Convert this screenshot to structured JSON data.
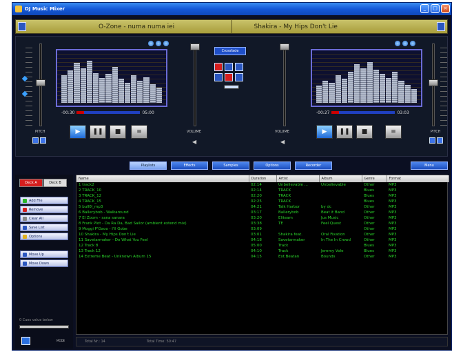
{
  "window": {
    "title": "DJ Music Mixer"
  },
  "marquee": {
    "left_song": "O-Zone - numa numa iei",
    "right_song": "Shakira - My Hips Don't Lie"
  },
  "deck_a": {
    "time_left": "-00:30",
    "time_right": "05:00",
    "pitch_label": "PITCH",
    "volume_label": "VOLUME"
  },
  "deck_b": {
    "time_left": "-00:27",
    "time_right": "03:03",
    "pitch_label": "PITCH",
    "volume_label": "VOLUME"
  },
  "mixer": {
    "top_label": "Crossfade"
  },
  "tabs": [
    {
      "label": "Playlists"
    },
    {
      "label": "Effects"
    },
    {
      "label": "Samples"
    },
    {
      "label": "Options"
    },
    {
      "label": "Recorder"
    },
    {
      "label": "Menu"
    }
  ],
  "left_panel": {
    "tab_a": "Deck A",
    "tab_b": "Deck B",
    "buttons": [
      {
        "label": "Add File"
      },
      {
        "label": "Remove"
      },
      {
        "label": "Clear All"
      },
      {
        "label": "Save List"
      },
      {
        "label": "Options"
      },
      {
        "label": "Move Up"
      },
      {
        "label": "Move Down"
      }
    ],
    "footer_text": "0 Cues value below",
    "mini_text": "MODE"
  },
  "playlist": {
    "headers": [
      "Name",
      "Duration",
      "Artist",
      "Album",
      "Genre",
      "Format"
    ],
    "rows": [
      [
        "1 track2",
        "02:14",
        "Unbelievable ...",
        "Unbelievable",
        "Other",
        "MP3"
      ],
      [
        "2 TRACK_10",
        "02:14",
        "TRACK",
        "",
        "Blues",
        "MP3"
      ],
      [
        "3 TRACK_12",
        "02:20",
        "TRACK",
        "",
        "Blues",
        "MP3"
      ],
      [
        "4 TRACK_15",
        "02:25",
        "TRACK",
        "",
        "Blues",
        "MP3"
      ],
      [
        "5 bull0l_mp3",
        "04:21",
        "Talk Harbor",
        "by dc",
        "Other",
        "MP3"
      ],
      [
        "6 Ballerybob - Walkaround",
        "03:17",
        "Ballerybob",
        "Beat it Band",
        "Other",
        "MP3"
      ],
      [
        "7 El Zoom - sana sanara",
        "03:20",
        "Eliteam",
        "Jus Music",
        "Other",
        "MP3"
      ],
      [
        "8 Frank Plot - Da Ra Da, Bad Sailor (ambient extend mix)",
        "03:38",
        "TE",
        "Feel Quest",
        "Other",
        "MP3"
      ],
      [
        "9 Moggi P'Gaoo - I'll Gobe",
        "03:09",
        "",
        "",
        "Other",
        "MP3"
      ],
      [
        "10 Shakira - My Hips Don't Lie",
        "03:01",
        "Shakira feat.",
        "Oral Fixation",
        "Other",
        "MP3"
      ],
      [
        "11 Savetarmaker - Do What You Feel",
        "04:18",
        "Savetarmaker",
        "In The In Crowd",
        "Other",
        "MP3"
      ],
      [
        "12 Track 8",
        "05:00",
        "Track",
        "",
        "Blues",
        "MP3"
      ],
      [
        "13 Track 12",
        "04:10",
        "Track",
        "Jeremy Vole",
        "Blues",
        "MP3"
      ],
      [
        "14 Extreme Beat - Unknown Album 15",
        "04:15",
        "Ext.Beatan",
        "Bounds",
        "Other",
        "MP3"
      ]
    ]
  },
  "status": {
    "total": "Total Nr.: 14",
    "total_time": "Total Time: 50:47"
  }
}
